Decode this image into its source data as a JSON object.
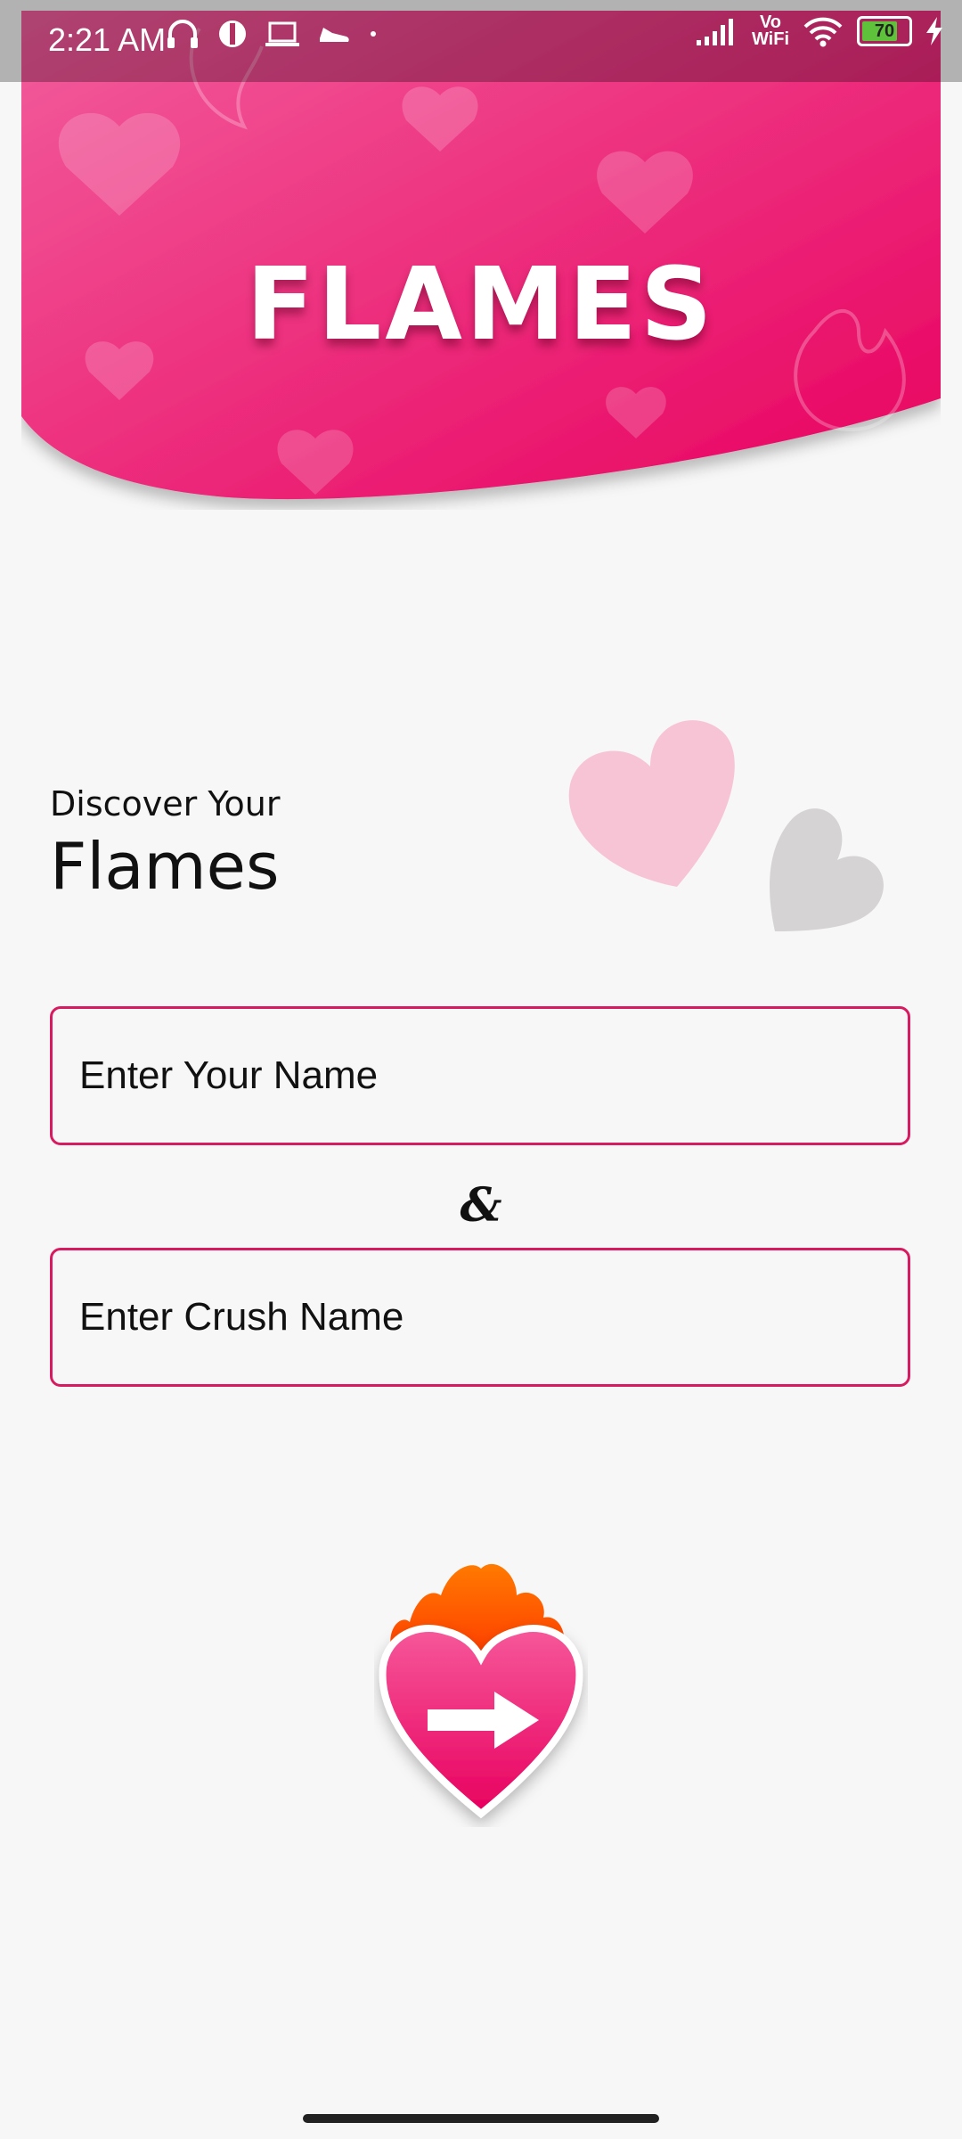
{
  "status_bar": {
    "time": "2:21 AM",
    "network_label": "Vo\nWiFi",
    "battery_level": "70",
    "icons": [
      "headphones-icon",
      "app-notification-icon",
      "laptop-icon",
      "shoe-icon",
      "dot-icon",
      "signal-icon",
      "wifi-icon",
      "battery-icon",
      "charging-icon"
    ]
  },
  "header": {
    "title": "FLAMES"
  },
  "intro": {
    "line1": "Discover Your",
    "line2": "Flames"
  },
  "form": {
    "your_name_placeholder": "Enter Your Name",
    "crush_name_placeholder": "Enter Crush Name",
    "separator": "&"
  },
  "colors": {
    "primary": "#ec1f70",
    "primary_light": "#f25d9c",
    "border": "#d81b60"
  },
  "submit": {
    "icon": "flaming-heart-arrow-icon"
  }
}
